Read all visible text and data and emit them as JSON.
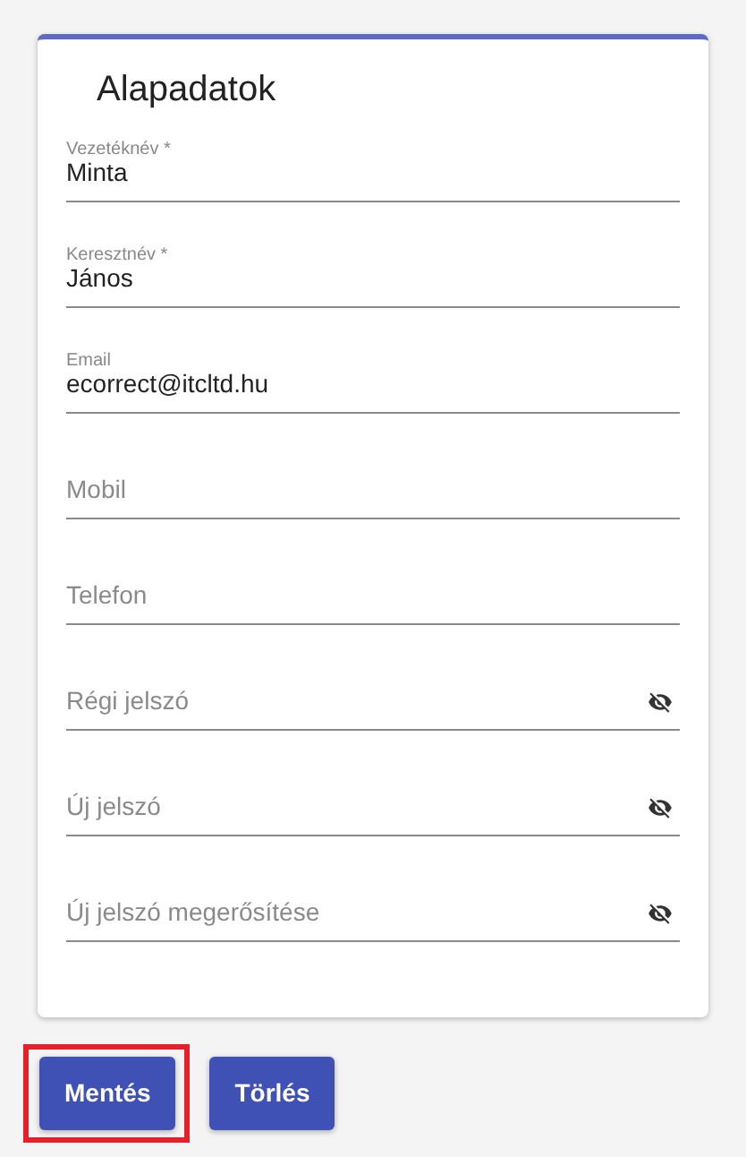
{
  "card": {
    "title": "Alapadatok",
    "fields": [
      {
        "kind": "text",
        "label": "Vezetéknév *",
        "value": "Minta"
      },
      {
        "kind": "text",
        "label": "Keresztnév *",
        "value": "János"
      },
      {
        "kind": "text",
        "label": "Email",
        "value": "ecorrect@itcltd.hu"
      },
      {
        "kind": "text",
        "placeholder": "Mobil"
      },
      {
        "kind": "text",
        "placeholder": "Telefon"
      },
      {
        "kind": "password",
        "placeholder": "Régi jelszó"
      },
      {
        "kind": "password",
        "placeholder": "Új jelszó"
      },
      {
        "kind": "password",
        "placeholder": "Új jelszó megerősítése"
      }
    ]
  },
  "buttons": [
    {
      "label": "Mentés",
      "highlighted": true
    },
    {
      "label": "Törlés",
      "highlighted": false
    }
  ]
}
